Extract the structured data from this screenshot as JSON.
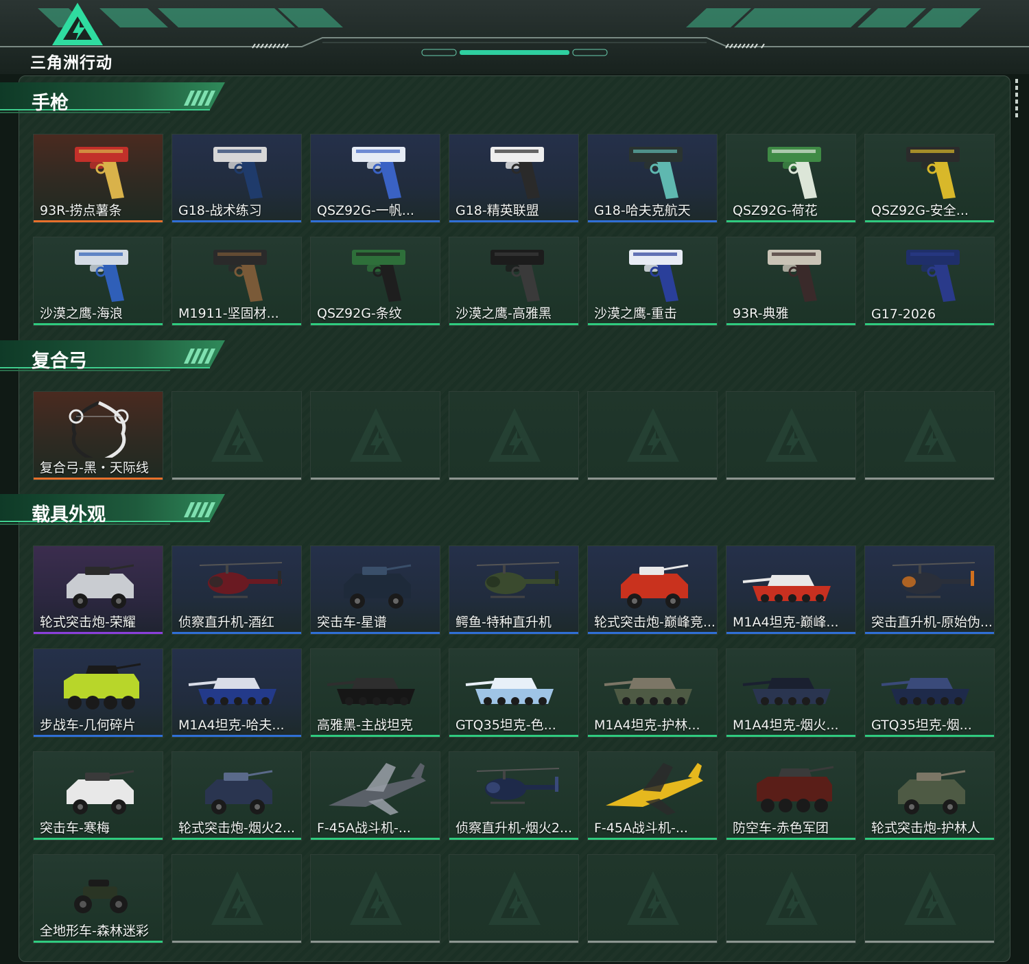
{
  "brand": {
    "name": "三角洲行动"
  },
  "sections": [
    {
      "title": "手枪",
      "items": [
        {
          "label": "93R-捞点薯条",
          "rarity": "orange",
          "icon": "pistol-icon",
          "c1": "#c2302a",
          "c2": "#d9b24a"
        },
        {
          "label": "G18-战术练习",
          "rarity": "blue",
          "icon": "pistol-icon",
          "c1": "#d7d7d7",
          "c2": "#1f3b6b"
        },
        {
          "label": "QSZ92G-一帆...",
          "rarity": "blue",
          "icon": "pistol-icon",
          "c1": "#e6ecf5",
          "c2": "#3a62c4"
        },
        {
          "label": "G18-精英联盟",
          "rarity": "blue",
          "icon": "pistol-icon",
          "c1": "#eeeeee",
          "c2": "#2a2a2a"
        },
        {
          "label": "G18-哈夫克航天",
          "rarity": "blue",
          "icon": "pistol-icon",
          "c1": "#2a3330",
          "c2": "#5fb8b0"
        },
        {
          "label": "QSZ92G-荷花",
          "rarity": "green",
          "icon": "pistol-icon",
          "c1": "#3f8a45",
          "c2": "#dce6d8"
        },
        {
          "label": "QSZ92G-安全...",
          "rarity": "green",
          "icon": "pistol-icon",
          "c1": "#2b2b2b",
          "c2": "#d8b82a"
        },
        {
          "label": "沙漠之鹰-海浪",
          "rarity": "green",
          "icon": "pistol-icon",
          "c1": "#d4dbe5",
          "c2": "#2f5fb8"
        },
        {
          "label": "M1911-坚固材...",
          "rarity": "green",
          "icon": "pistol-icon",
          "c1": "#2a2a2a",
          "c2": "#7a5a38"
        },
        {
          "label": "QSZ92G-条纹",
          "rarity": "green",
          "icon": "pistol-icon",
          "c1": "#2e6f3a",
          "c2": "#1e1e1e"
        },
        {
          "label": "沙漠之鹰-高雅黑",
          "rarity": "green",
          "icon": "pistol-icon",
          "c1": "#1c1c1c",
          "c2": "#3a3a3a"
        },
        {
          "label": "沙漠之鹰-重击",
          "rarity": "green",
          "icon": "pistol-icon",
          "c1": "#e8ecf5",
          "c2": "#2a3f9a"
        },
        {
          "label": "93R-典雅",
          "rarity": "green",
          "icon": "pistol-icon",
          "c1": "#c9c3b6",
          "c2": "#3a2a2a"
        },
        {
          "label": "G17-2026",
          "rarity": "green",
          "icon": "pistol-icon",
          "c1": "#1f2f6a",
          "c2": "#2a3a8a"
        }
      ]
    },
    {
      "title": "复合弓",
      "items": [
        {
          "label": "复合弓-黑・天际线",
          "rarity": "orange",
          "icon": "bow-icon",
          "c1": "#e8e8e8",
          "c2": "#222222"
        },
        {
          "empty": true
        },
        {
          "empty": true
        },
        {
          "empty": true
        },
        {
          "empty": true
        },
        {
          "empty": true
        },
        {
          "empty": true
        }
      ]
    },
    {
      "title": "载具外观",
      "items": [
        {
          "label": "轮式突击炮-荣耀",
          "rarity": "purple",
          "icon": "armored-car-icon",
          "c1": "#c9ccd1",
          "c2": "#2a2a2a"
        },
        {
          "label": "侦察直升机-酒红",
          "rarity": "blue",
          "icon": "helicopter-icon",
          "c1": "#6a1a22",
          "c2": "#2a2a2a"
        },
        {
          "label": "突击车-星谱",
          "rarity": "blue",
          "icon": "armored-car-icon",
          "c1": "#1e2a3a",
          "c2": "#3a4f6a"
        },
        {
          "label": "鳄鱼-特种直升机",
          "rarity": "blue",
          "icon": "helicopter-icon",
          "c1": "#3a4a2e",
          "c2": "#23301f"
        },
        {
          "label": "轮式突击炮-巅峰竞...",
          "rarity": "blue",
          "icon": "armored-car-icon",
          "c1": "#c9321e",
          "c2": "#e8e8e8"
        },
        {
          "label": "M1A4坦克-巅峰...",
          "rarity": "blue",
          "icon": "tank-icon",
          "c1": "#c83020",
          "c2": "#e8e8e8"
        },
        {
          "label": "突击直升机-原始伪...",
          "rarity": "blue",
          "icon": "helicopter-icon",
          "c1": "#2a2f3a",
          "c2": "#d0701e"
        },
        {
          "label": "步战车-几何碎片",
          "rarity": "blue",
          "icon": "apc-icon",
          "c1": "#b8d62a",
          "c2": "#1a1a1a"
        },
        {
          "label": "M1A4坦克-哈夫...",
          "rarity": "blue",
          "icon": "tank-icon",
          "c1": "#233a8a",
          "c2": "#d9dde8"
        },
        {
          "label": "高雅黑-主战坦克",
          "rarity": "green",
          "icon": "tank-icon",
          "c1": "#161616",
          "c2": "#2e2e2e"
        },
        {
          "label": "GTQ35坦克-色...",
          "rarity": "green",
          "icon": "tank-icon",
          "c1": "#9fc4e6",
          "c2": "#e8f0f8"
        },
        {
          "label": "M1A4坦克-护林...",
          "rarity": "green",
          "icon": "tank-icon",
          "c1": "#4e5a44",
          "c2": "#7c7666"
        },
        {
          "label": "M1A4坦克-烟火...",
          "rarity": "green",
          "icon": "tank-icon",
          "c1": "#2a3550",
          "c2": "#1a2030"
        },
        {
          "label": "GTQ35坦克-烟...",
          "rarity": "green",
          "icon": "tank-icon",
          "c1": "#1e2a4a",
          "c2": "#3a4a7a"
        },
        {
          "label": "突击车-寒梅",
          "rarity": "green",
          "icon": "armored-car-icon",
          "c1": "#e8e8e8",
          "c2": "#3a3a3a"
        },
        {
          "label": "轮式突击炮-烟火2...",
          "rarity": "green",
          "icon": "armored-car-icon",
          "c1": "#2a3550",
          "c2": "#5a6a8a"
        },
        {
          "label": "F-45A战斗机-...",
          "rarity": "green",
          "icon": "jet-icon",
          "c1": "#5a6068",
          "c2": "#9aa0a8"
        },
        {
          "label": "侦察直升机-烟火2...",
          "rarity": "green",
          "icon": "helicopter-icon",
          "c1": "#1e2a4a",
          "c2": "#3a4a7a"
        },
        {
          "label": "F-45A战斗机-...",
          "rarity": "green",
          "icon": "jet-icon",
          "c1": "#e6b81e",
          "c2": "#2a2a2a"
        },
        {
          "label": "防空车-赤色军团",
          "rarity": "green",
          "icon": "apc-icon",
          "c1": "#5a1e18",
          "c2": "#3a3a3a"
        },
        {
          "label": "轮式突击炮-护林人",
          "rarity": "green",
          "icon": "armored-car-icon",
          "c1": "#4e5a44",
          "c2": "#7c7666"
        },
        {
          "label": "全地形车-森林迷彩",
          "rarity": "green",
          "icon": "atv-icon",
          "c1": "#2a3524",
          "c2": "#1a1a1a"
        },
        {
          "empty": true
        },
        {
          "empty": true
        },
        {
          "empty": true
        },
        {
          "empty": true
        },
        {
          "empty": true
        },
        {
          "empty": true
        }
      ]
    }
  ]
}
